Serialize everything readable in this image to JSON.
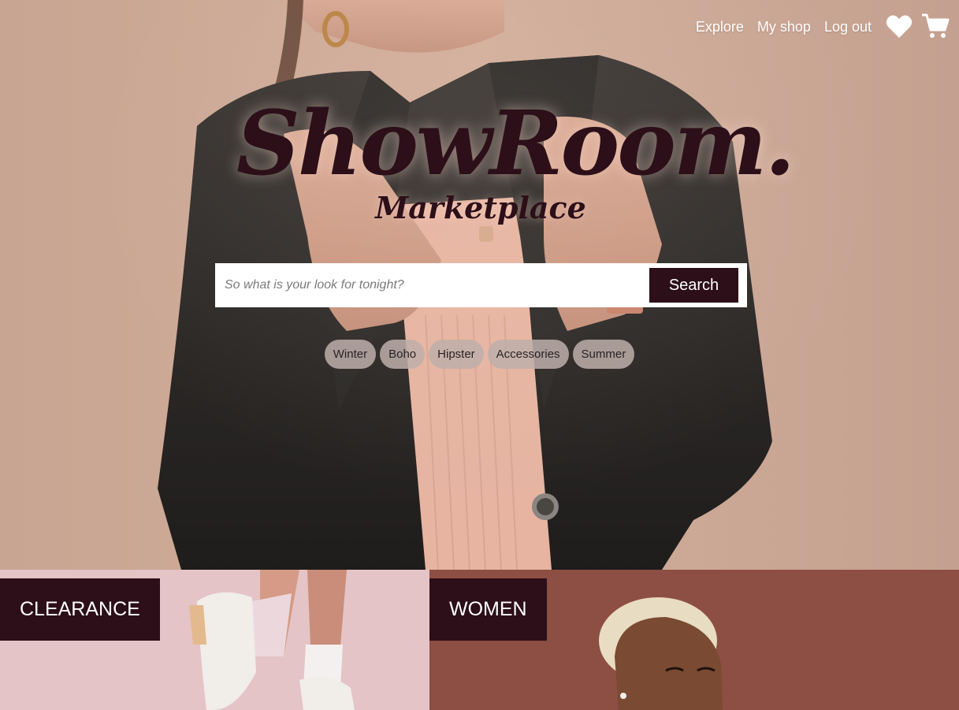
{
  "nav": {
    "explore": "Explore",
    "my_shop": "My shop",
    "log_out": "Log out",
    "icons": [
      "heart-icon",
      "cart-icon"
    ]
  },
  "logo": {
    "main": "ShowRoom.",
    "sub": "Marketplace"
  },
  "search": {
    "placeholder": "So what is your look for tonight?",
    "button": "Search"
  },
  "tags": [
    "Winter",
    "Boho",
    "Hipster",
    "Accessories",
    "Summer"
  ],
  "categories": [
    {
      "label": "CLEARANCE"
    },
    {
      "label": "WOMEN"
    }
  ],
  "colors": {
    "brand_dark": "#2c0f18",
    "hero_bg": "#c9a594",
    "clearance_bg": "#e4c4c6",
    "women_bg": "#8d4e43",
    "tag_bg": "#beafaa"
  }
}
